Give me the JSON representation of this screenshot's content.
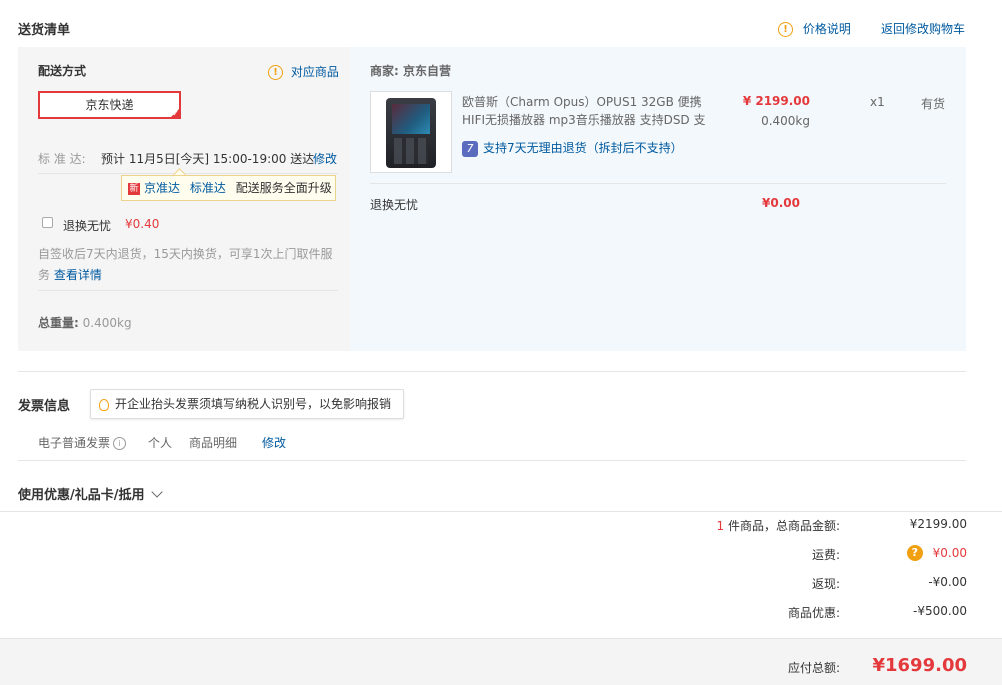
{
  "delivery": {
    "title": "送货清单",
    "price_note": "价格说明",
    "back_to_cart": "返回修改购物车"
  },
  "shipping": {
    "title": "配送方式",
    "related_goods": "对应商品",
    "method": "京东快递",
    "standard_label": "标 准 达:",
    "standard_time": "预计 11月5日[今天] 15:00-19:00 送达",
    "modify": "修改",
    "tip_new": "新",
    "tip_jzd": "京准达",
    "tip_bzd": "标准达",
    "tip_text": "配送服务全面升级",
    "worry_free_label": "退换无忧",
    "worry_free_price": "¥0.40",
    "worry_free_desc": "自签收后7天内退货，15天内换货，可享1次上门取件服务",
    "view_detail": "查看详情",
    "total_weight_label": "总重量:",
    "total_weight_value": "0.400kg"
  },
  "seller": {
    "label": "商家:",
    "name": "京东自营"
  },
  "product": {
    "name_line1": "欧普斯（Charm Opus）OPUS1 32GB 便携",
    "name_line2": "HIFI无损播放器 mp3音乐播放器 支持DSD 支",
    "price": "¥ 2199.00",
    "weight": "0.400kg",
    "quantity": "x1",
    "stock": "有货",
    "return_badge": "7",
    "return_policy": "支持7天无理由退货（拆封后不支持）",
    "service_name": "退换无忧",
    "service_price": "¥0.00"
  },
  "invoice": {
    "title": "发票信息",
    "tip": "开企业抬头发票须填写纳税人识别号，以免影响报销",
    "type": "电子普通发票",
    "holder": "个人",
    "content": "商品明细",
    "modify": "修改"
  },
  "coupon": {
    "title": "使用优惠/礼品卡/抵用"
  },
  "summary": {
    "count": "1",
    "count_label": "件商品，总商品金额:",
    "goods_total": "¥2199.00",
    "freight_label": "运费:",
    "freight_value": "¥0.00",
    "cashback_label": "返现:",
    "cashback_value": "-¥0.00",
    "discount_label": "商品优惠:",
    "discount_value": "-¥500.00",
    "payable_label": "应付总额:",
    "payable_value": "¥1699.00"
  },
  "colors": {
    "accent": "#e4393c",
    "link": "#005aa0",
    "warning": "#f0a010"
  }
}
